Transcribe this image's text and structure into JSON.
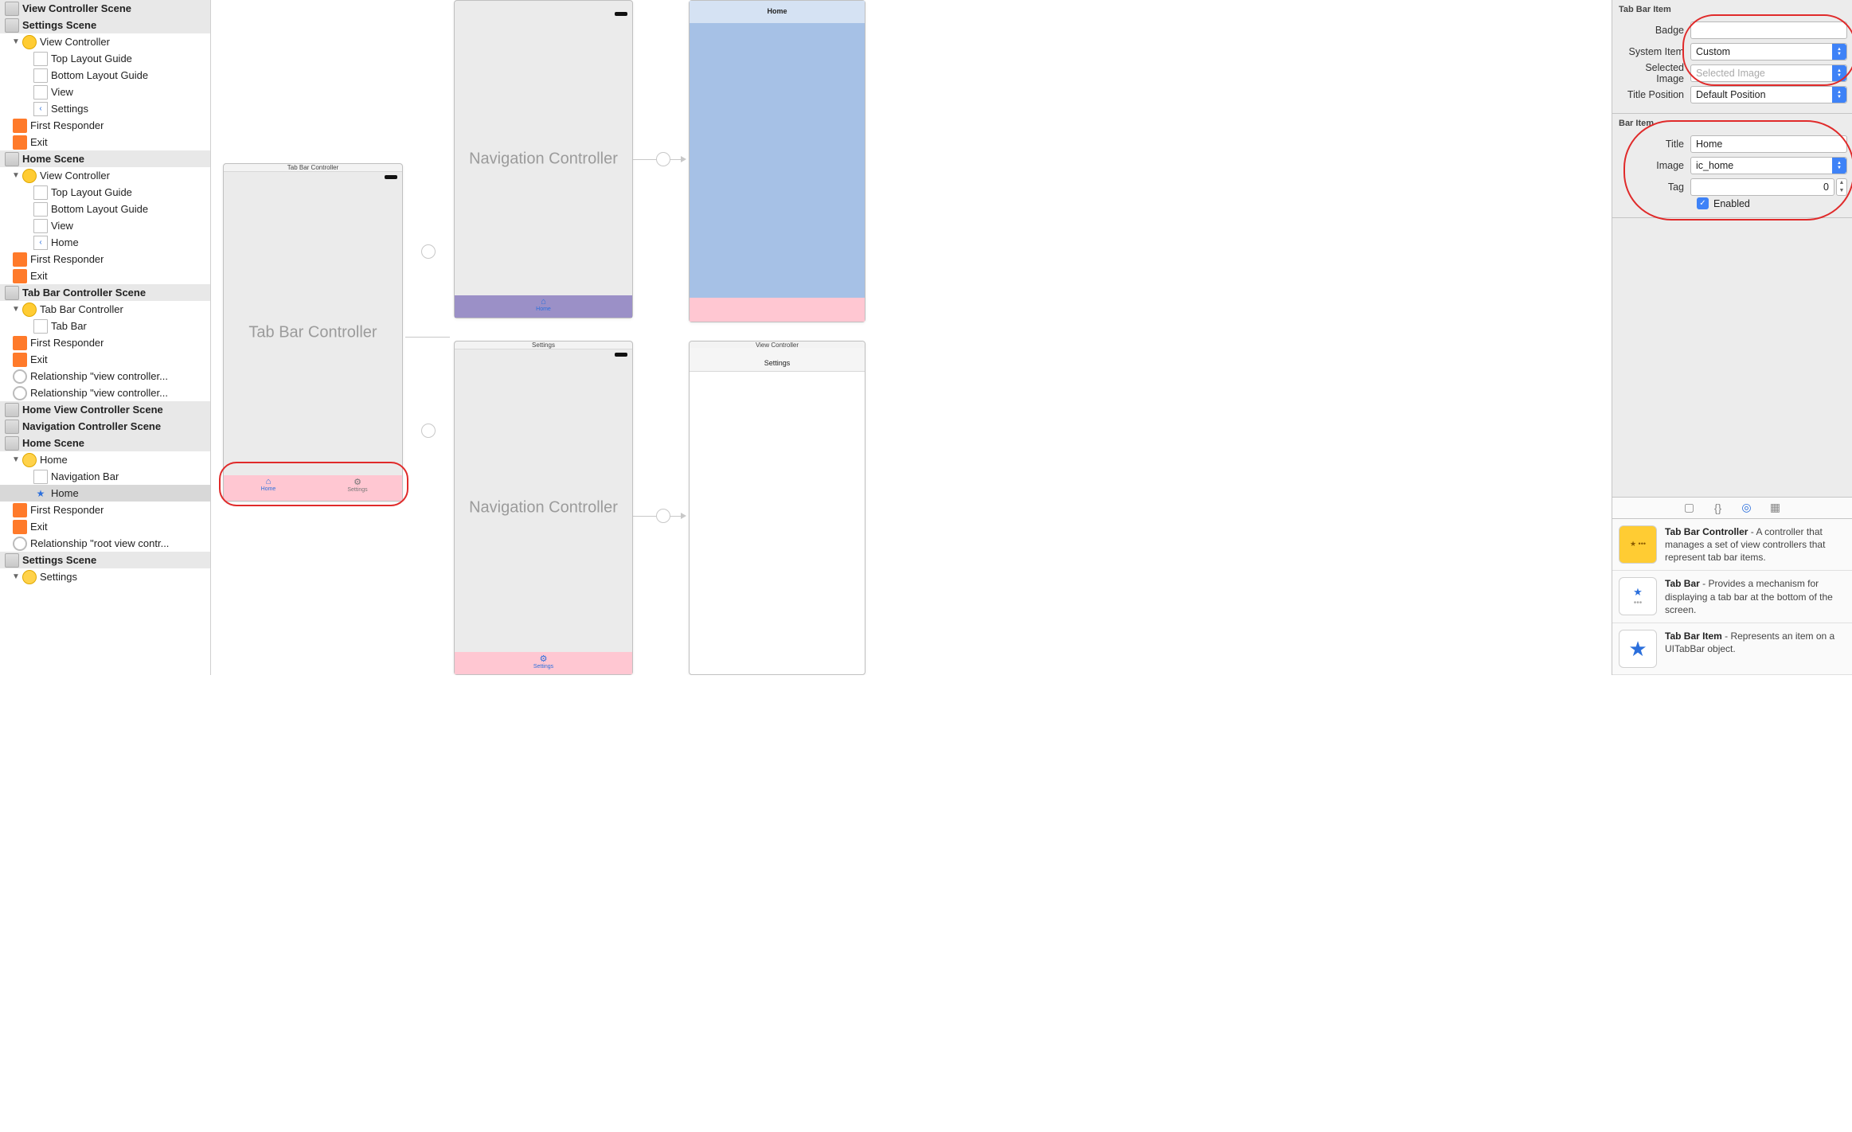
{
  "outline": {
    "scenes": [
      {
        "title": "View Controller Scene",
        "children": []
      },
      {
        "title": "Settings Scene",
        "children": [
          {
            "icon": "vc",
            "label": "View Controller",
            "disclosure": "open",
            "indent": 1,
            "children": [
              {
                "icon": "square",
                "label": "Top Layout Guide",
                "indent": 2
              },
              {
                "icon": "square",
                "label": "Bottom Layout Guide",
                "indent": 2
              },
              {
                "icon": "square",
                "label": "View",
                "indent": 2
              },
              {
                "icon": "back",
                "label": "Settings",
                "indent": 2
              }
            ]
          },
          {
            "icon": "cube",
            "label": "First Responder",
            "indent": 1
          },
          {
            "icon": "exit",
            "label": "Exit",
            "indent": 1
          }
        ]
      },
      {
        "title": "Home Scene",
        "children": [
          {
            "icon": "vc",
            "label": "View Controller",
            "disclosure": "open",
            "indent": 1,
            "children": [
              {
                "icon": "square",
                "label": "Top Layout Guide",
                "indent": 2
              },
              {
                "icon": "square",
                "label": "Bottom Layout Guide",
                "indent": 2
              },
              {
                "icon": "square",
                "label": "View",
                "indent": 2
              },
              {
                "icon": "back",
                "label": "Home",
                "indent": 2
              }
            ]
          },
          {
            "icon": "cube",
            "label": "First Responder",
            "indent": 1
          },
          {
            "icon": "exit",
            "label": "Exit",
            "indent": 1
          }
        ]
      },
      {
        "title": "Tab Bar Controller Scene",
        "children": [
          {
            "icon": "vc",
            "label": "Tab Bar Controller",
            "disclosure": "open",
            "indent": 1,
            "children": [
              {
                "icon": "square",
                "label": "Tab Bar",
                "indent": 2
              }
            ]
          },
          {
            "icon": "cube",
            "label": "First Responder",
            "indent": 1
          },
          {
            "icon": "exit",
            "label": "Exit",
            "indent": 1
          },
          {
            "icon": "rel",
            "label": "Relationship \"view controller...",
            "indent": 1
          },
          {
            "icon": "rel",
            "label": "Relationship \"view controller...",
            "indent": 1
          }
        ]
      },
      {
        "title": "Home View Controller Scene",
        "children": []
      },
      {
        "title": "Navigation Controller Scene",
        "children": []
      },
      {
        "title": "Home Scene",
        "children": [
          {
            "icon": "vc-arrow",
            "label": "Home",
            "disclosure": "open",
            "indent": 1,
            "children": [
              {
                "icon": "square",
                "label": "Navigation Bar",
                "indent": 2
              },
              {
                "icon": "star",
                "label": "Home",
                "indent": 2,
                "selected": true
              }
            ]
          },
          {
            "icon": "cube",
            "label": "First Responder",
            "indent": 1
          },
          {
            "icon": "exit",
            "label": "Exit",
            "indent": 1
          },
          {
            "icon": "rel",
            "label": "Relationship \"root view contr...",
            "indent": 1
          }
        ]
      },
      {
        "title": "Settings Scene",
        "children": [
          {
            "icon": "vc-arrow",
            "label": "Settings",
            "disclosure": "open",
            "indent": 1
          }
        ]
      }
    ]
  },
  "canvas": {
    "tabbar_controller": {
      "title": "Tab Bar Controller",
      "body": "Tab Bar Controller",
      "tabs": [
        {
          "icon": "⌂",
          "label": "Home"
        },
        {
          "icon": "⚙",
          "label": "Settings"
        }
      ]
    },
    "nav_controller_1": {
      "body": "Navigation Controller",
      "tab": {
        "icon": "⌂",
        "label": "Home"
      }
    },
    "nav_controller_2": {
      "title": "Settings",
      "body": "Navigation Controller",
      "tab": {
        "icon": "⚙",
        "label": "Settings"
      }
    },
    "home_scene": {
      "nav_title": "Home"
    },
    "vc_scene": {
      "title": "View Controller",
      "nav_title": "Settings"
    }
  },
  "inspector": {
    "tabbaritem": {
      "header": "Tab Bar Item",
      "badge_label": "Badge",
      "badge_value": "",
      "system_item_label": "System Item",
      "system_item_value": "Custom",
      "selected_image_label": "Selected Image",
      "selected_image_placeholder": "Selected Image",
      "title_position_label": "Title Position",
      "title_position_value": "Default Position"
    },
    "baritem": {
      "header": "Bar Item",
      "title_label": "Title",
      "title_value": "Home",
      "image_label": "Image",
      "image_value": "ic_home",
      "tag_label": "Tag",
      "tag_value": "0",
      "enabled_label": "Enabled",
      "enabled_checked": true
    }
  },
  "library": {
    "items": [
      {
        "name": "Tab Bar Controller",
        "desc": " - A controller that manages a set of view controllers that represent tab bar items.",
        "thumb": "yellow"
      },
      {
        "name": "Tab Bar",
        "desc": " - Provides a mechanism for displaying a tab bar at the bottom of the screen.",
        "thumb": "tabbar"
      },
      {
        "name": "Tab Bar Item",
        "desc": " - Represents an item on a UITabBar object.",
        "thumb": "star"
      }
    ]
  }
}
